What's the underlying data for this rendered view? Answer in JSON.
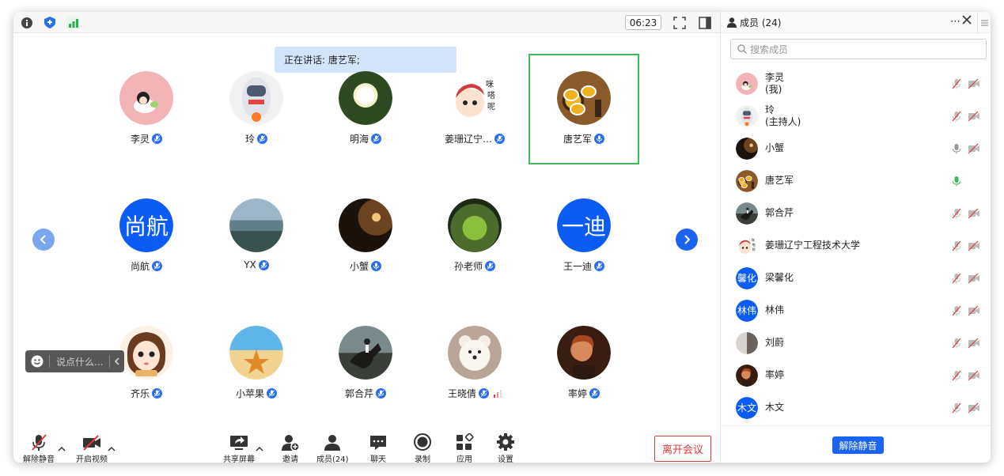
{
  "topbar": {
    "timer": "06:23"
  },
  "speaking": {
    "text": "正在讲话: 唐艺军;"
  },
  "grid": [
    {
      "name": "李灵",
      "mic": "muted",
      "av": "girl-sticker"
    },
    {
      "name": "玲",
      "mic": "muted",
      "av": "astronaut"
    },
    {
      "name": "明海",
      "mic": "muted",
      "av": "lotus"
    },
    {
      "name": "姜珊辽宁…",
      "mic": "muted",
      "av": "cartoon"
    },
    {
      "name": "唐艺军",
      "mic": "active",
      "av": "tea",
      "active": true
    },
    {
      "name": "尚航",
      "mic": "muted",
      "av": "text",
      "text": "尚航"
    },
    {
      "name": "YX",
      "mic": "muted",
      "av": "sea"
    },
    {
      "name": "小蟹",
      "mic": "on",
      "av": "night"
    },
    {
      "name": "孙老师",
      "mic": "muted",
      "av": "moss"
    },
    {
      "name": "王一迪",
      "mic": "muted",
      "av": "text",
      "text": "一迪"
    },
    {
      "name": "齐乐",
      "mic": "muted",
      "av": "girl"
    },
    {
      "name": "小苹果",
      "mic": "muted",
      "av": "beach"
    },
    {
      "name": "郭合芹",
      "mic": "muted",
      "av": "horse"
    },
    {
      "name": "王晓倩",
      "mic": "muted",
      "av": "bear",
      "signal": true
    },
    {
      "name": "率婷",
      "mic": "muted",
      "av": "man"
    }
  ],
  "chat": {
    "placeholder": "说点什么..."
  },
  "toolbar": {
    "unmute": "解除静音",
    "video": "开启视频",
    "share": "共享屏幕",
    "invite": "邀请",
    "members": "成员(24)",
    "chat": "聊天",
    "record": "录制",
    "apps": "应用",
    "settings": "设置",
    "leave": "离开会议"
  },
  "sidebar": {
    "title": "成员 (24)",
    "search_placeholder": "搜索成员",
    "unmute_all": "解除静音",
    "members": [
      {
        "name": "李灵",
        "sub": "(我)",
        "av": "girl-sticker",
        "mic": "muted",
        "cam": "off"
      },
      {
        "name": "玲",
        "sub": "(主持人)",
        "av": "astronaut",
        "mic": "muted",
        "cam": "off"
      },
      {
        "name": "小蟹",
        "sub": "",
        "av": "night",
        "mic": "on-gray",
        "cam": "off"
      },
      {
        "name": "唐艺军",
        "sub": "",
        "av": "tea",
        "mic": "green",
        "cam": "none"
      },
      {
        "name": "郭合芹",
        "sub": "",
        "av": "horse",
        "mic": "muted",
        "cam": "off"
      },
      {
        "name": "姜珊辽宁工程技术大学",
        "sub": "",
        "av": "cartoon",
        "mic": "muted",
        "cam": "off"
      },
      {
        "name": "梁馨化",
        "sub": "",
        "av": "text",
        "text": "馨化",
        "mic": "muted",
        "cam": "off"
      },
      {
        "name": "林伟",
        "sub": "",
        "av": "text",
        "text": "林伟",
        "mic": "muted",
        "cam": "off"
      },
      {
        "name": "刘蔚",
        "sub": "",
        "av": "room",
        "mic": "muted",
        "cam": "off"
      },
      {
        "name": "率婷",
        "sub": "",
        "av": "man",
        "mic": "muted",
        "cam": "off"
      },
      {
        "name": "木文",
        "sub": "",
        "av": "text",
        "text": "木文",
        "mic": "muted",
        "cam": "off"
      }
    ]
  },
  "colors": {
    "accent": "#1a64f0",
    "active_border": "#3dbb5a",
    "danger": "#e03a3a"
  }
}
